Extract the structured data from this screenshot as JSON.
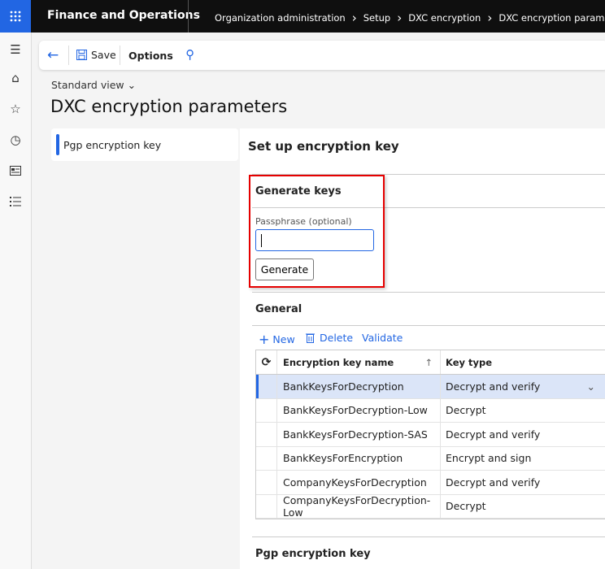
{
  "header": {
    "app_title": "Finance and Operations",
    "breadcrumb": [
      "Organization administration",
      "Setup",
      "DXC encryption",
      "DXC encryption parameters"
    ]
  },
  "toolbar": {
    "save": "Save",
    "options": "Options"
  },
  "page": {
    "view": "Standard view",
    "title": "DXC encryption parameters"
  },
  "left_pane": {
    "items": [
      "Pgp encryption key"
    ]
  },
  "main": {
    "section_title": "Set up encryption key",
    "generate": {
      "title": "Generate keys",
      "passphrase_label": "Passphrase (optional)",
      "passphrase_value": "",
      "button": "Generate"
    },
    "general": {
      "title": "General",
      "actions": {
        "new": "New",
        "delete": "Delete",
        "validate": "Validate"
      },
      "columns": [
        "Encryption key name",
        "Key type"
      ],
      "rows": [
        {
          "name": "BankKeysForDecryption",
          "type": "Decrypt and verify"
        },
        {
          "name": "BankKeysForDecryption-Low",
          "type": "Decrypt"
        },
        {
          "name": "BankKeysForDecryption-SAS",
          "type": "Decrypt and verify"
        },
        {
          "name": "BankKeysForEncryption",
          "type": "Encrypt and sign"
        },
        {
          "name": "CompanyKeysForDecryption",
          "type": "Decrypt and verify"
        },
        {
          "name": "CompanyKeysForDecryption-Low",
          "type": "Decrypt"
        }
      ]
    },
    "pgp_title": "Pgp encryption key"
  },
  "colors": {
    "accent": "#2266e3",
    "highlight": "#e60000",
    "selected_row": "#dbe5f8"
  }
}
